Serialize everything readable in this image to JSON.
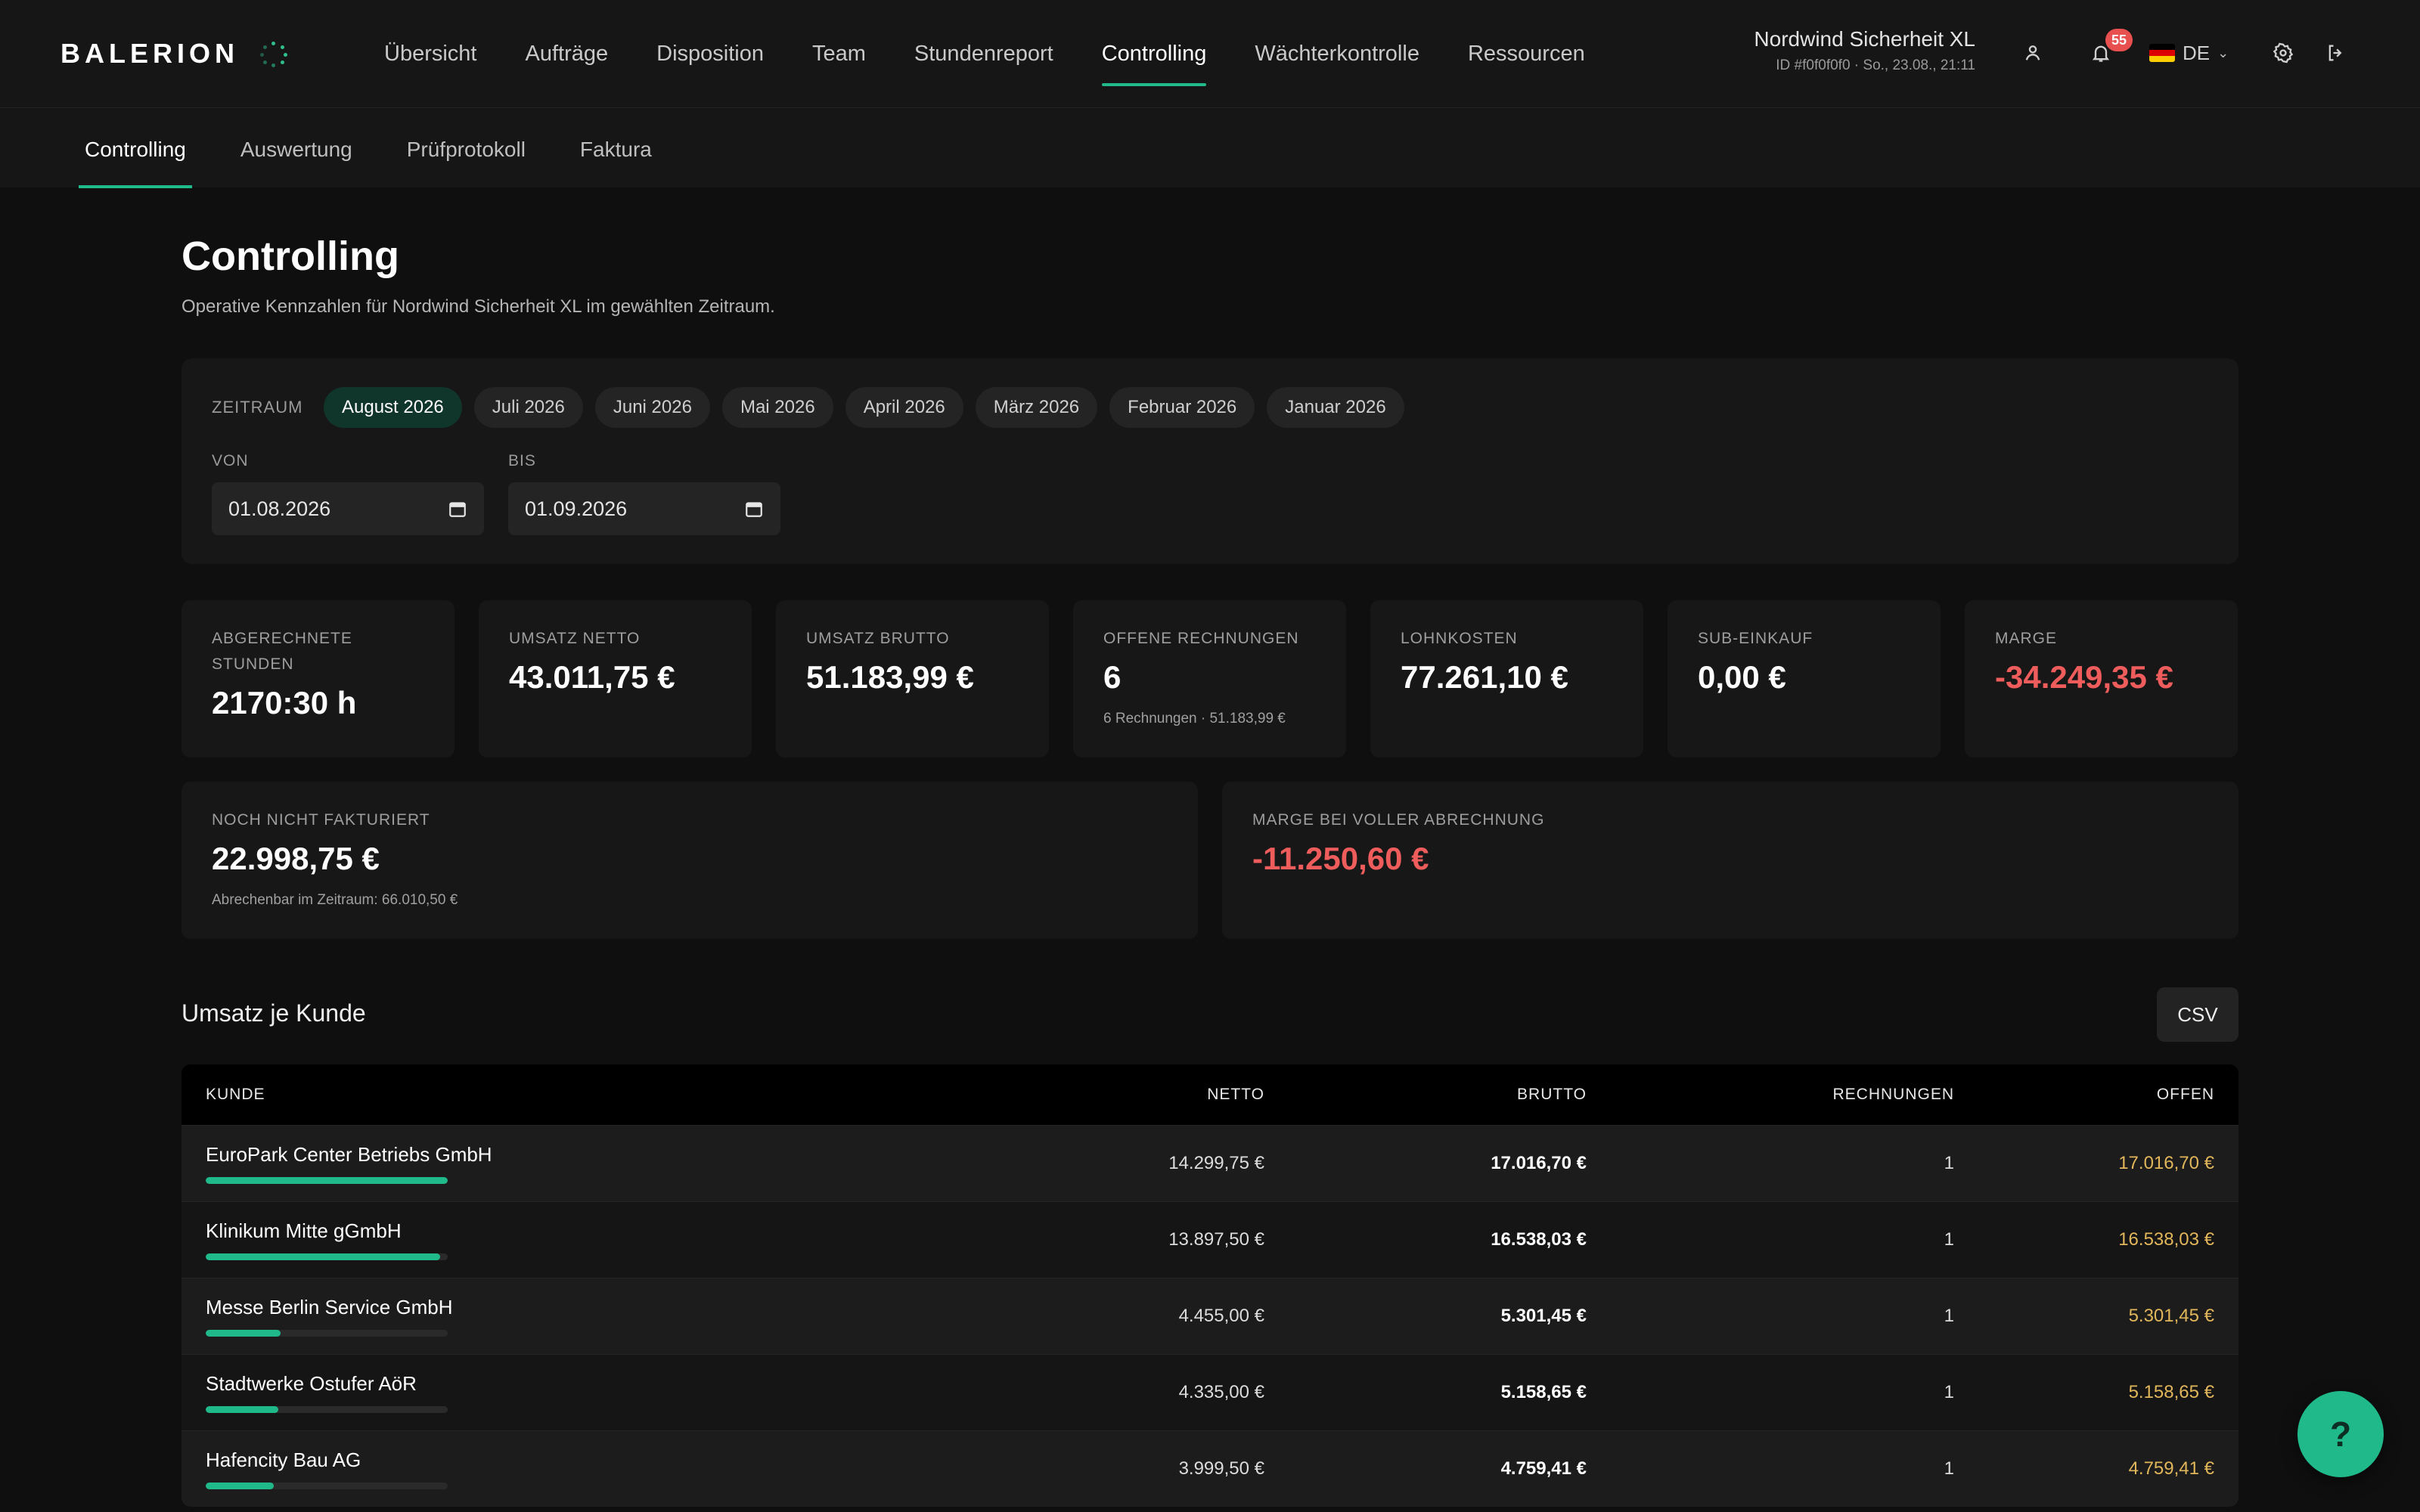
{
  "brand": {
    "name": "BALERION",
    "accent": "#1fb98a"
  },
  "nav": {
    "items": [
      {
        "label": "Übersicht",
        "active": false
      },
      {
        "label": "Aufträge",
        "active": false
      },
      {
        "label": "Disposition",
        "active": false
      },
      {
        "label": "Team",
        "active": false
      },
      {
        "label": "Stundenreport",
        "active": false
      },
      {
        "label": "Controlling",
        "active": true
      },
      {
        "label": "Wächterkontrolle",
        "active": false
      },
      {
        "label": "Ressourcen",
        "active": false
      }
    ]
  },
  "account": {
    "name": "Nordwind Sicherheit XL",
    "meta": "ID #f0f0f0f0 · So., 23.08., 21:11",
    "notification_count": "55",
    "language": "DE"
  },
  "subnav": {
    "items": [
      {
        "label": "Controlling",
        "active": true
      },
      {
        "label": "Auswertung",
        "active": false
      },
      {
        "label": "Prüfprotokoll",
        "active": false
      },
      {
        "label": "Faktura",
        "active": false
      }
    ]
  },
  "page": {
    "title": "Controlling",
    "subtitle": "Operative Kennzahlen für Nordwind Sicherheit XL im gewählten Zeitraum."
  },
  "filter": {
    "period_label": "ZEITRAUM",
    "periods": [
      {
        "label": "August 2026",
        "active": true
      },
      {
        "label": "Juli 2026",
        "active": false
      },
      {
        "label": "Juni 2026",
        "active": false
      },
      {
        "label": "Mai 2026",
        "active": false
      },
      {
        "label": "April 2026",
        "active": false
      },
      {
        "label": "März 2026",
        "active": false
      },
      {
        "label": "Februar 2026",
        "active": false
      },
      {
        "label": "Januar 2026",
        "active": false
      }
    ],
    "from_label": "VON",
    "from_value": "01.08.2026",
    "to_label": "BIS",
    "to_value": "01.09.2026"
  },
  "kpis": [
    {
      "label": "ABGERECHNETE STUNDEN",
      "value": "2170:30 h",
      "note": "",
      "negative": false
    },
    {
      "label": "UMSATZ NETTO",
      "value": "43.011,75 €",
      "note": "",
      "negative": false
    },
    {
      "label": "UMSATZ BRUTTO",
      "value": "51.183,99 €",
      "note": "",
      "negative": false
    },
    {
      "label": "OFFENE RECHNUNGEN",
      "value": "6",
      "note": "6 Rechnungen · 51.183,99 €",
      "negative": false
    },
    {
      "label": "LOHNKOSTEN",
      "value": "77.261,10 €",
      "note": "",
      "negative": false
    },
    {
      "label": "SUB-EINKAUF",
      "value": "0,00 €",
      "note": "",
      "negative": false
    },
    {
      "label": "MARGE",
      "value": "-34.249,35 €",
      "note": "",
      "negative": true
    }
  ],
  "kpis_wide": [
    {
      "label": "NOCH NICHT FAKTURIERT",
      "value": "22.998,75 €",
      "note": "Abrechenbar im Zeitraum: 66.010,50 €",
      "negative": false
    },
    {
      "label": "MARGE BEI VOLLER ABRECHNUNG",
      "value": "-11.250,60 €",
      "note": "",
      "negative": true
    }
  ],
  "revenue_by_customer": {
    "title": "Umsatz je Kunde",
    "csv_label": "CSV",
    "columns": {
      "kunde": "KUNDE",
      "netto": "NETTO",
      "brutto": "BRUTTO",
      "rechnungen": "RECHNUNGEN",
      "offen": "OFFEN"
    },
    "rows": [
      {
        "kunde": "EuroPark Center Betriebs GmbH",
        "share": 1.0,
        "netto": "14.299,75 €",
        "brutto": "17.016,70 €",
        "rechnungen": "1",
        "offen": "17.016,70 €"
      },
      {
        "kunde": "Klinikum Mitte gGmbH",
        "share": 0.97,
        "netto": "13.897,50 €",
        "brutto": "16.538,03 €",
        "rechnungen": "1",
        "offen": "16.538,03 €"
      },
      {
        "kunde": "Messe Berlin Service GmbH",
        "share": 0.31,
        "netto": "4.455,00 €",
        "brutto": "5.301,45 €",
        "rechnungen": "1",
        "offen": "5.301,45 €"
      },
      {
        "kunde": "Stadtwerke Ostufer AöR",
        "share": 0.3,
        "netto": "4.335,00 €",
        "brutto": "5.158,65 €",
        "rechnungen": "1",
        "offen": "5.158,65 €"
      },
      {
        "kunde": "Hafencity Bau AG",
        "share": 0.28,
        "netto": "3.999,50 €",
        "brutto": "4.759,41 €",
        "rechnungen": "1",
        "offen": "4.759,41 €"
      }
    ]
  },
  "help": {
    "label": "?"
  }
}
